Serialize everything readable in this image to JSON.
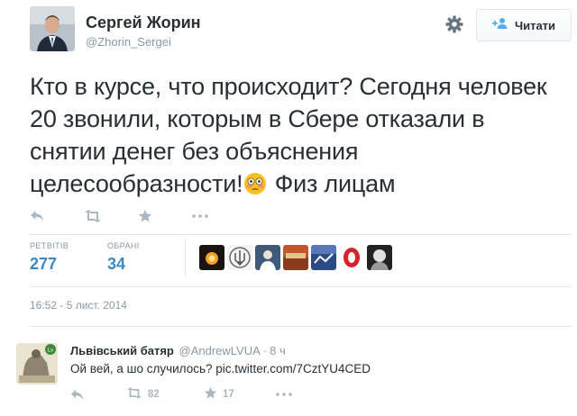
{
  "tweet": {
    "author_name": "Сергей Жорин",
    "author_handle": "@Zhorin_Sergei",
    "follow_label": "Читати",
    "text_before_emoji": "Кто в курсе, что происходит? Сегодня человек 20 звонили, которым в Сбере отказали в снятии денег без объяснения целесообразности!",
    "text_after_emoji": " Физ лицам",
    "emoji_name": "flushed-face-emoji",
    "retweets_label": "РЕТВІТІВ",
    "retweets_count": "277",
    "favorites_label": "ОБРАНІ",
    "favorites_count": "34",
    "timestamp": "16:52 - 5 лист. 2014"
  },
  "reply": {
    "author_name": "Львівський батяр",
    "author_handle": "@AndrewLVUA",
    "separator": "·",
    "time": "8 ч",
    "text": "Ой вей, а шо случилось?",
    "link": "pic.twitter.com/7CztYU4CED",
    "retweet_count": "82",
    "favorite_count": "17"
  },
  "icons": {
    "actions": [
      "reply-icon",
      "retweet-icon",
      "favorite-star-icon",
      "more-icon"
    ],
    "header": [
      "gear-icon",
      "follow-plus-icon"
    ]
  },
  "colors": {
    "link_blue": "#3b88c3",
    "muted_gray": "#8899a6",
    "icon_gray": "#aab8c2",
    "text_dark": "#292f33",
    "divider": "#e1e8ed"
  }
}
